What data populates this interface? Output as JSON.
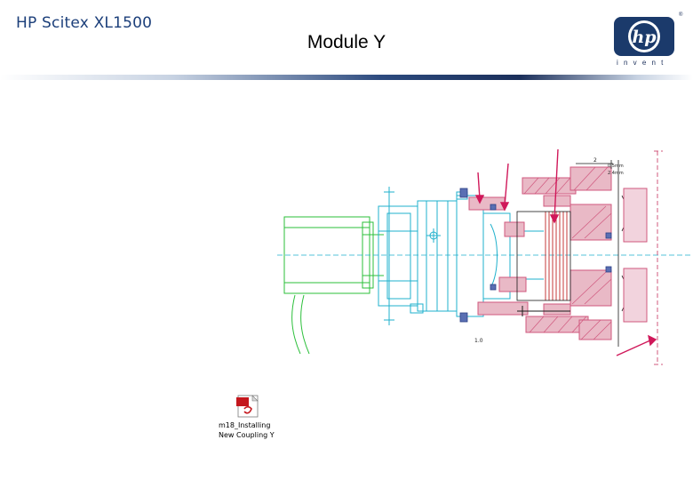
{
  "header": {
    "brand": "HP Scitex XL1500",
    "title": "Module Y",
    "logo_text": "hp",
    "logo_tagline": "invent",
    "trademark": "®"
  },
  "drawing": {
    "dimension_labels": {
      "top_right": "2",
      "gap_top": "0.5mm",
      "gap_bottom": "2.4mm",
      "bottom": "1.0"
    },
    "colors": {
      "line": "#1fb0cc",
      "motor": "#2bbf3a",
      "part_fill": "#e9b9c6",
      "hatch": "#d0587e",
      "arrow": "#d0185a",
      "core": "#c43a3a"
    }
  },
  "attachment": {
    "icon": "pdf-file-icon",
    "label_line1": "m18_Installing",
    "label_line2": "New Coupling Y"
  },
  "colors": {
    "brand_blue": "#1c3f7a",
    "logo_blue": "#1b3a6b"
  }
}
